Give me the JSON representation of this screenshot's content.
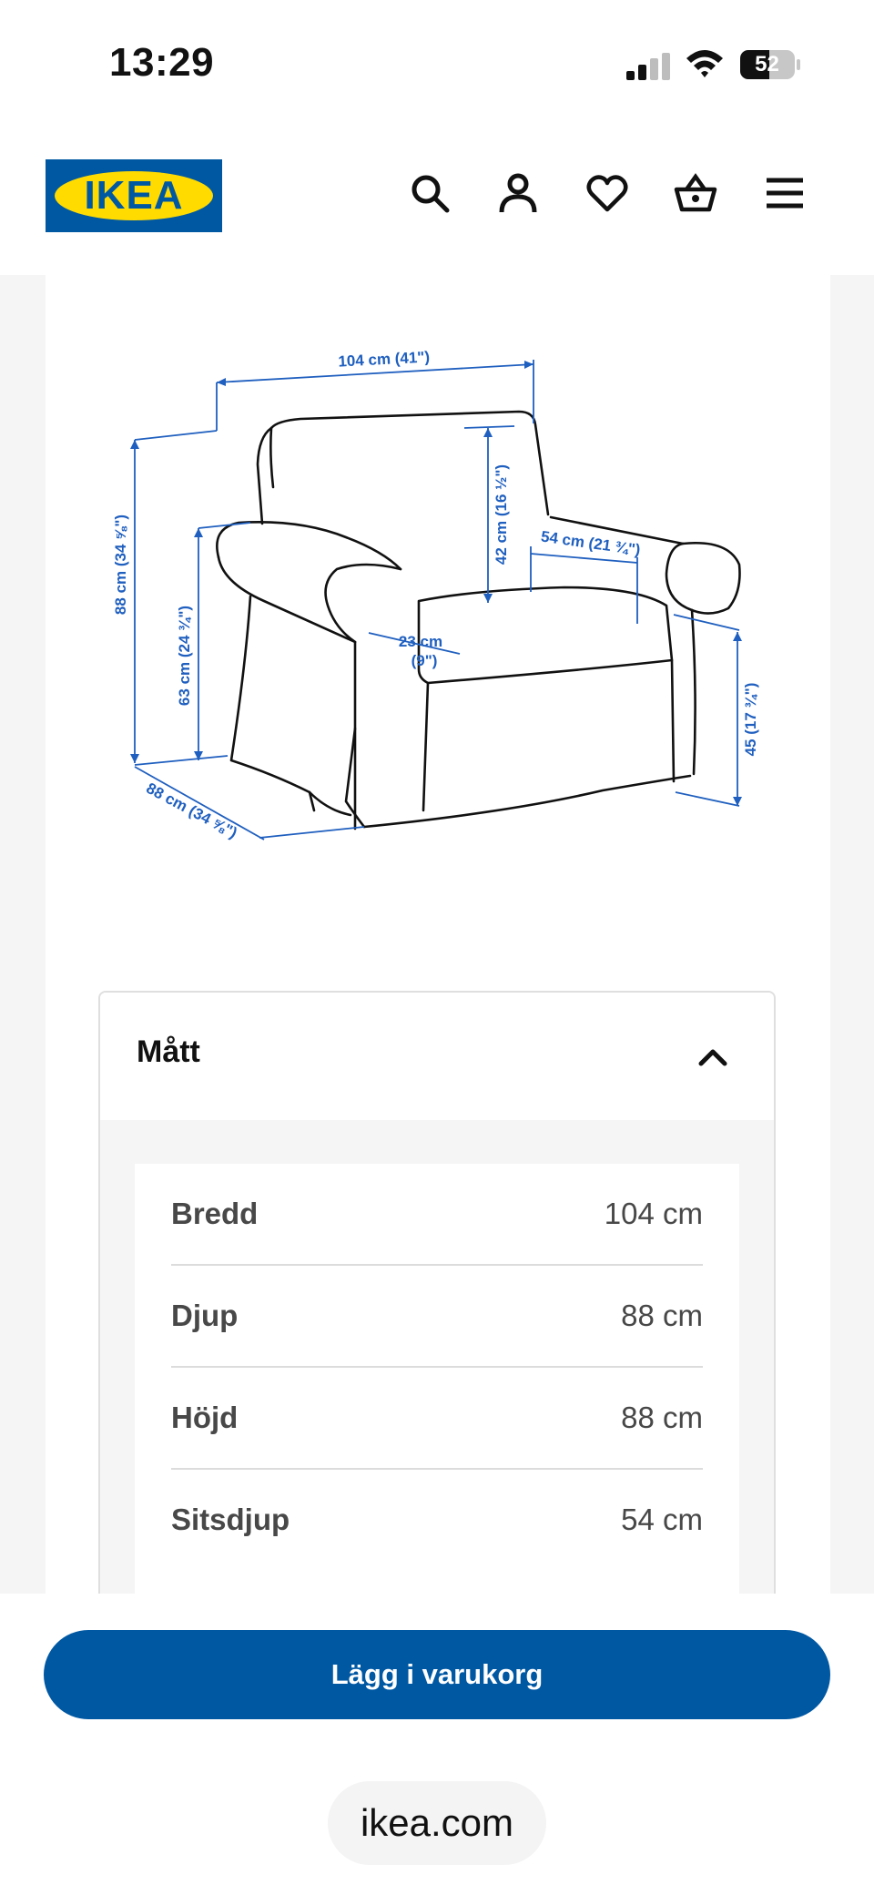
{
  "status_bar": {
    "time": "13:29",
    "battery": "52"
  },
  "header": {
    "logo_text": "IKEA",
    "icons": [
      "search-icon",
      "account-icon",
      "heart-icon",
      "basket-icon",
      "menu-icon"
    ]
  },
  "diagram": {
    "width_label": "104 cm (41\")",
    "height_label": "88 cm (34 ⅝\")",
    "depth_label": "88 cm (34 ⅝\")",
    "arm_height_label": "63 cm (24 ¾\")",
    "back_height_label": "42 cm (16 ½\")",
    "seat_depth_label": "54 cm (21 ¾\")",
    "arm_width_label_1": "23 cm",
    "arm_width_label_2": "(9\")",
    "seat_height_label": "45 (17 ¾\")"
  },
  "dimensions": {
    "title": "Mått",
    "rows": [
      {
        "label": "Bredd",
        "value": "104 cm"
      },
      {
        "label": "Djup",
        "value": "88 cm"
      },
      {
        "label": "Höjd",
        "value": "88 cm"
      },
      {
        "label": "Sitsdjup",
        "value": "54 cm"
      }
    ]
  },
  "cta": {
    "add_to_cart": "Lägg i varukorg"
  },
  "browser": {
    "url": "ikea.com"
  },
  "colors": {
    "brand_blue": "#0058a3",
    "brand_yellow": "#ffdb00",
    "diagram_blue": "#1f5fbf"
  }
}
